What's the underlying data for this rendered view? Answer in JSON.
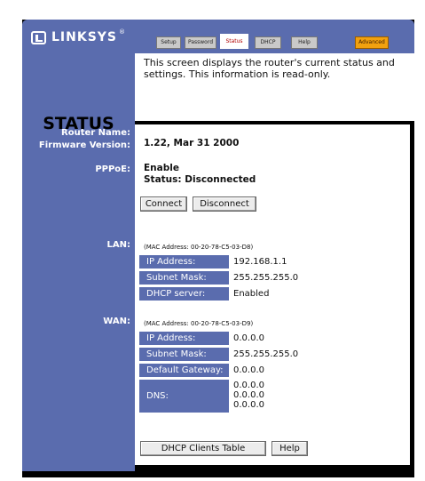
{
  "brand": {
    "name": "LINKSYS",
    "reg": "®"
  },
  "tabs": [
    {
      "label": "Setup"
    },
    {
      "label": "Password"
    },
    {
      "label": "Status"
    },
    {
      "label": "DHCP"
    },
    {
      "label": "Help"
    },
    {
      "label": "Advanced"
    }
  ],
  "page": {
    "title": "STATUS",
    "description": "This screen displays the router's current status and settings. This information is read-only."
  },
  "labels": {
    "router_name": "Router Name:",
    "firmware": "Firmware Version:",
    "pppoe": "PPPoE:",
    "lan": "LAN:",
    "wan": "WAN:"
  },
  "firmware_value": "1.22, Mar 31 2000",
  "pppoe": {
    "enable": "Enable",
    "status": "Status: Disconnected",
    "connect_label": "Connect",
    "disconnect_label": "Disconnect"
  },
  "lan": {
    "mac": "(MAC Address: 00-20-78-C5-03-D8)",
    "rows": [
      {
        "label": "IP Address:",
        "value": "192.168.1.1"
      },
      {
        "label": "Subnet Mask:",
        "value": "255.255.255.0"
      },
      {
        "label": "DHCP server:",
        "value": "Enabled"
      }
    ]
  },
  "wan": {
    "mac": "(MAC Address: 00-20-78-C5-03-D9)",
    "rows": [
      {
        "label": "IP Address:",
        "value": "0.0.0.0"
      },
      {
        "label": "Subnet Mask:",
        "value": "255.255.255.0"
      },
      {
        "label": "Default Gateway:",
        "value": "0.0.0.0"
      }
    ],
    "dns_label": "DNS:",
    "dns": [
      "0.0.0.0",
      "0.0.0.0",
      "0.0.0.0"
    ]
  },
  "buttons": {
    "dhcp_clients": "DHCP Clients Table",
    "help": "Help"
  },
  "colors": {
    "frame": "#000000",
    "bar": "#5a6cae",
    "advanced_tab": "#f2a10f",
    "active_tab_text": "#b00000"
  }
}
